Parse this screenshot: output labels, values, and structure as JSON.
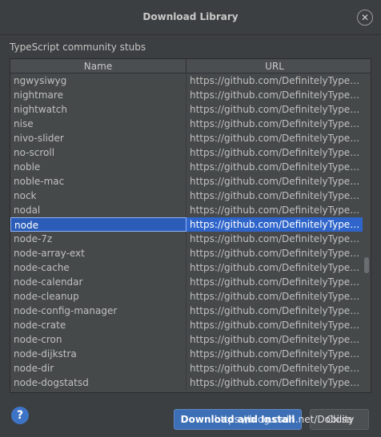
{
  "dialog": {
    "title": "Download Library",
    "close_glyph": "✕"
  },
  "section_label": "TypeScript community stubs",
  "table": {
    "columns": [
      "Name",
      "URL"
    ],
    "selected_index": 10,
    "rows": [
      {
        "name": "ngwysiwyg",
        "url": "https://github.com/DefinitelyTyped/..."
      },
      {
        "name": "nightmare",
        "url": "https://github.com/DefinitelyTyped/..."
      },
      {
        "name": "nightwatch",
        "url": "https://github.com/DefinitelyTyped/..."
      },
      {
        "name": "nise",
        "url": "https://github.com/DefinitelyTyped/..."
      },
      {
        "name": "nivo-slider",
        "url": "https://github.com/DefinitelyTyped/..."
      },
      {
        "name": "no-scroll",
        "url": "https://github.com/DefinitelyTyped/..."
      },
      {
        "name": "noble",
        "url": "https://github.com/DefinitelyTyped/..."
      },
      {
        "name": "noble-mac",
        "url": "https://github.com/DefinitelyTyped/..."
      },
      {
        "name": "nock",
        "url": "https://github.com/DefinitelyTyped/..."
      },
      {
        "name": "nodal",
        "url": "https://github.com/DefinitelyTyped/..."
      },
      {
        "name": "node",
        "url": "https://github.com/DefinitelyTyped/..."
      },
      {
        "name": "node-7z",
        "url": "https://github.com/DefinitelyTyped/..."
      },
      {
        "name": "node-array-ext",
        "url": "https://github.com/DefinitelyTyped/..."
      },
      {
        "name": "node-cache",
        "url": "https://github.com/DefinitelyTyped/..."
      },
      {
        "name": "node-calendar",
        "url": "https://github.com/DefinitelyTyped/..."
      },
      {
        "name": "node-cleanup",
        "url": "https://github.com/DefinitelyTyped/..."
      },
      {
        "name": "node-config-manager",
        "url": "https://github.com/DefinitelyTyped/..."
      },
      {
        "name": "node-crate",
        "url": "https://github.com/DefinitelyTyped/..."
      },
      {
        "name": "node-cron",
        "url": "https://github.com/DefinitelyTyped/..."
      },
      {
        "name": "node-dijkstra",
        "url": "https://github.com/DefinitelyTyped/..."
      },
      {
        "name": "node-dir",
        "url": "https://github.com/DefinitelyTyped/..."
      },
      {
        "name": "node-dogstatsd",
        "url": "https://github.com/DefinitelyTyped/..."
      }
    ]
  },
  "footer": {
    "help_glyph": "?",
    "primary_label": "Download and Install",
    "secondary_label": "Close"
  },
  "watermark": "https://blog.csdn.net/Dobility",
  "colors": {
    "background": "#3c3f41",
    "selection": "#2f65ca",
    "primary_button": "#3d6fb6",
    "help_icon": "#3d74c6"
  }
}
